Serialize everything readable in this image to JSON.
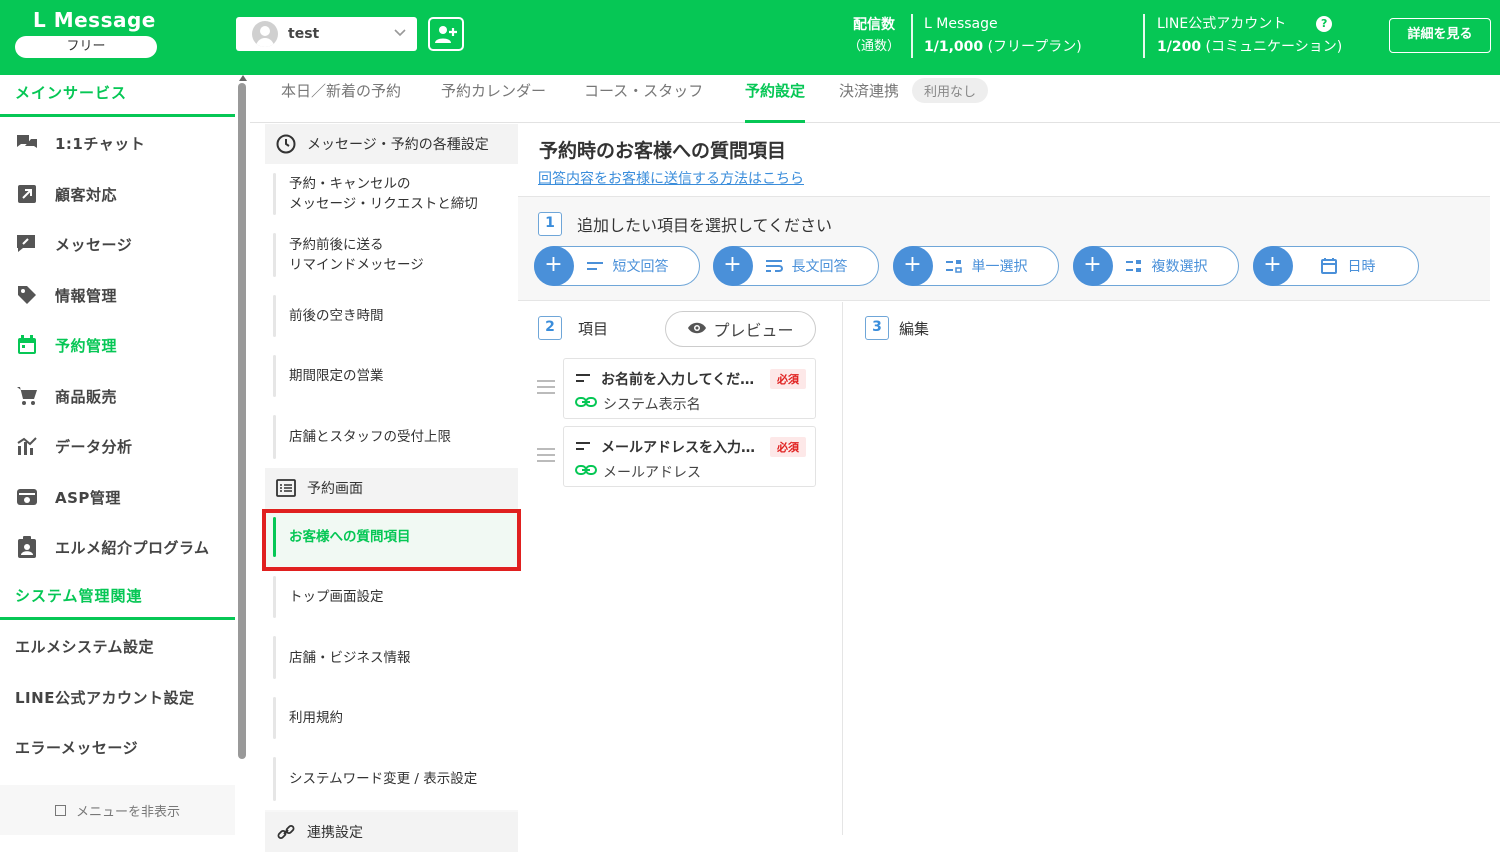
{
  "header": {
    "brand_name": "L Message",
    "plan_badge": "フリー",
    "account_name": "test",
    "stat_label": "配信数",
    "stat_sublabel": "（通数）",
    "lmsg_label": "L Message",
    "lmsg_value": "1/1,000",
    "lmsg_plan": "(フリープラン)",
    "line_label": "LINE公式アカウント",
    "line_value": "1/200",
    "line_plan": "(コミュニケーション)",
    "detail_button": "詳細を見る",
    "accent_color": "#06c755"
  },
  "sidebar": {
    "section_main": "メインサービス",
    "items": [
      {
        "label": "1:1チャット",
        "icon": "chat-icon"
      },
      {
        "label": "顧客対応",
        "icon": "arrow-box-icon"
      },
      {
        "label": "メッセージ",
        "icon": "message-edit-icon"
      },
      {
        "label": "情報管理",
        "icon": "tag-icon"
      },
      {
        "label": "予約管理",
        "icon": "calendar-icon"
      },
      {
        "label": "商品販売",
        "icon": "cart-icon"
      },
      {
        "label": "データ分析",
        "icon": "chart-icon"
      },
      {
        "label": "ASP管理",
        "icon": "asp-icon"
      },
      {
        "label": "エルメ紹介プログラム",
        "icon": "clipboard-user-icon"
      }
    ],
    "section_system": "システム管理関連",
    "system_items": [
      "エルメシステム設定",
      "LINE公式アカウント設定",
      "エラーメッセージ"
    ],
    "hide_menu": "メニューを非表示"
  },
  "tabs": {
    "items": [
      "本日／新着の予約",
      "予約カレンダー",
      "コース・スタッフ",
      "予約設定",
      "決済連携"
    ],
    "active": "予約設定",
    "badge": "利用なし"
  },
  "settings_nav": {
    "group1": "メッセージ・予約の各種設定",
    "group1_items": [
      "予約・キャンセルの\nメッセージ・リクエストと締切",
      "予約前後に送る\nリマインドメッセージ",
      "前後の空き時間",
      "期間限定の営業",
      "店舗とスタッフの受付上限"
    ],
    "group2": "予約画面",
    "group2_items": [
      "お客様への質問項目",
      "トップ画面設定",
      "店舗・ビジネス情報",
      "利用規約",
      "システムワード変更 / 表示設定"
    ],
    "group3": "連携設定"
  },
  "main": {
    "title": "予約時のお客様への質問項目",
    "help_link": "回答内容をお客様に送信する方法はこちら",
    "step1": {
      "num": "1",
      "label": "追加したい項目を選択してください"
    },
    "question_types": [
      {
        "label": "短文回答",
        "icon": "short-text-icon"
      },
      {
        "label": "長文回答",
        "icon": "long-text-icon"
      },
      {
        "label": "単一選択",
        "icon": "single-select-icon"
      },
      {
        "label": "複数選択",
        "icon": "multi-select-icon"
      },
      {
        "label": "日時",
        "icon": "calendar-icon"
      }
    ],
    "step2": {
      "num": "2",
      "label": "項目"
    },
    "preview_button": "プレビュー",
    "step3": {
      "num": "3",
      "label": "編集"
    },
    "questions": [
      {
        "title": "お名前を入力してくだ…",
        "required": "必須",
        "mapping": "システム表示名"
      },
      {
        "title": "メールアドレスを入力…",
        "required": "必須",
        "mapping": "メールアドレス"
      }
    ]
  }
}
